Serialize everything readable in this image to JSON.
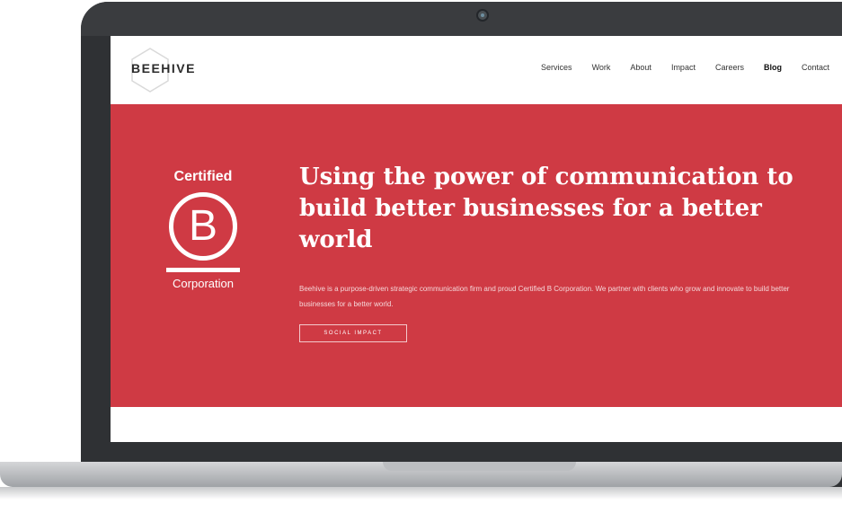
{
  "site": {
    "logo": "BEEHIVE",
    "nav": [
      "Services",
      "Work",
      "About",
      "Impact",
      "Careers",
      "Blog",
      "Contact"
    ],
    "active_nav": "Blog"
  },
  "bcorp": {
    "top": "Certified",
    "letter": "B",
    "bottom": "Corporation"
  },
  "hero": {
    "headline": "Using the power of communication to build better businesses for a better world",
    "subcopy": "Beehive is a purpose-driven strategic communication firm and proud Certified B Corporation. We partner with clients who grow and innovate to build better businesses for a better world.",
    "cta": "SOCIAL IMPACT"
  },
  "colors": {
    "hero_red": "#cf3a44",
    "device_dark": "#2f3134",
    "device_base": "#c9cbce"
  },
  "icons": {
    "camera": "camera-icon",
    "logo_mark": "hexagon-icon"
  }
}
